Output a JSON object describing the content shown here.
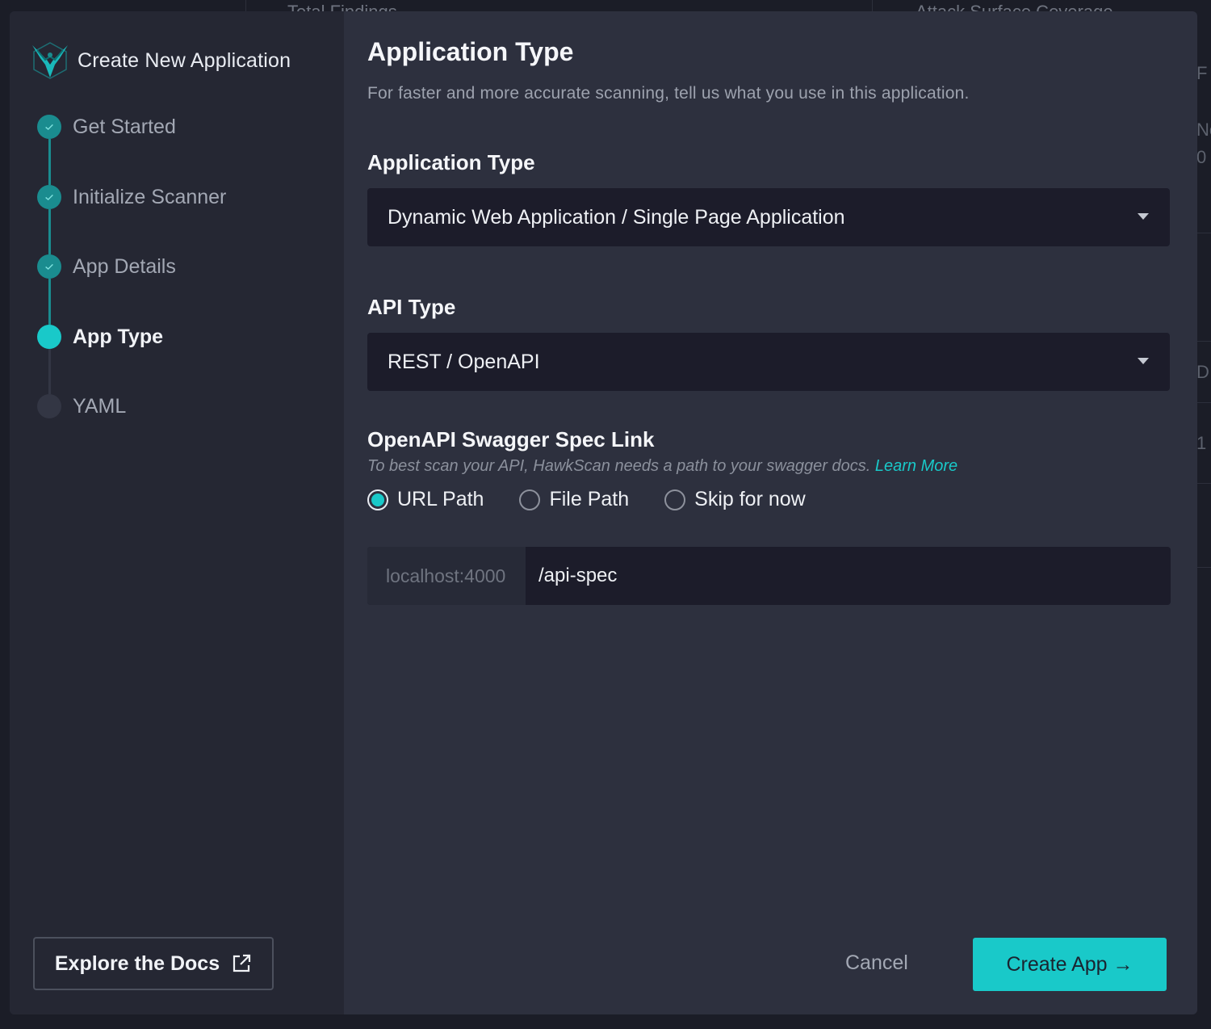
{
  "background": {
    "top_texts": [
      "Total Findings",
      "Attack Surface Coverage"
    ],
    "right_glyphs": [
      "F",
      "No",
      "0",
      "D",
      "1"
    ]
  },
  "sidebar": {
    "title": "Create New Application",
    "steps": [
      {
        "label": "Get Started",
        "state": "done"
      },
      {
        "label": "Initialize Scanner",
        "state": "done"
      },
      {
        "label": "App Details",
        "state": "done"
      },
      {
        "label": "App Type",
        "state": "current"
      },
      {
        "label": "YAML",
        "state": "pending"
      }
    ],
    "docs_button": "Explore the Docs"
  },
  "main": {
    "title": "Application Type",
    "subtitle": "For faster and more accurate scanning, tell us what you use in this application.",
    "app_type": {
      "label": "Application Type",
      "value": "Dynamic Web Application / Single Page Application"
    },
    "api_type": {
      "label": "API Type",
      "value": "REST / OpenAPI"
    },
    "openapi": {
      "label": "OpenAPI Swagger Spec Link",
      "hint": "To best scan your API, HawkScan needs a path to your swagger docs.",
      "learn_more": "Learn More",
      "options": [
        {
          "label": "URL Path",
          "selected": true
        },
        {
          "label": "File Path",
          "selected": false
        },
        {
          "label": "Skip for now",
          "selected": false
        }
      ],
      "url_prefix": "localhost:4000",
      "url_value": "/api-spec"
    },
    "cancel_label": "Cancel",
    "create_label": "Create App →"
  },
  "colors": {
    "accent": "#19c9c9",
    "done": "#1a8c8f",
    "modal_bg": "#2d303e",
    "sidebar_bg": "#252733",
    "input_bg": "#1c1c2a"
  }
}
